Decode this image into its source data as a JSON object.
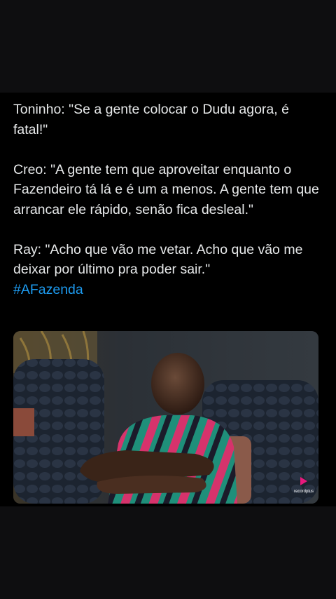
{
  "post": {
    "paragraphs": [
      "Toninho: \"Se a gente colocar o Dudu agora, é fatal!\"",
      "Creo: \"A gente tem que aproveitar enquanto o Fazendeiro tá lá e é um a menos. A gente tem que arrancar ele rápido, senão fica desleal.\"",
      "Ray: \"Acho que vão me vetar. Acho que vão me deixar por último pra poder sair.\""
    ],
    "hashtag": "#AFazenda"
  },
  "media": {
    "watermark": "recordplus",
    "watermark_color": "#e8197d"
  },
  "colors": {
    "background": "#0e0e10",
    "card": "#000000",
    "text": "#e7e9ea",
    "hashtag": "#1d9bf0"
  }
}
